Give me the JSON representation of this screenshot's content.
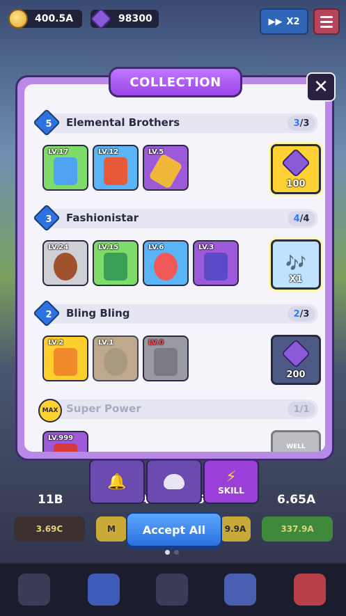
{
  "topbar": {
    "gold": "400.5A",
    "gems": "98300",
    "speed": "X2"
  },
  "modal": {
    "title": "COLLECTION",
    "sets": [
      {
        "badge": "5",
        "name": "Elemental Brothers",
        "have": "3",
        "total": "/3",
        "items": [
          {
            "lv": "LV.17"
          },
          {
            "lv": "LV.12"
          },
          {
            "lv": "LV.5"
          }
        ],
        "reward": "100"
      },
      {
        "badge": "3",
        "name": "Fashionistar",
        "have": "4",
        "total": "/4",
        "items": [
          {
            "lv": "LV.24"
          },
          {
            "lv": "LV.15"
          },
          {
            "lv": "LV.6"
          },
          {
            "lv": "LV.3"
          }
        ],
        "reward": "X1"
      },
      {
        "badge": "2",
        "name": "Bling Bling",
        "have": "2",
        "total": "/3",
        "items": [
          {
            "lv": "LV.2"
          },
          {
            "lv": "LV.1"
          },
          {
            "lv": "LV.0"
          }
        ],
        "reward": "200"
      },
      {
        "badge": "MAX",
        "name": "Super Power",
        "have": "",
        "total": "1/1",
        "items": [
          {
            "lv": "LV.999"
          }
        ],
        "reward": "WELL"
      }
    ]
  },
  "skill_tab": "SKILL",
  "accept_all": "Accept All",
  "stats": [
    "11B",
    "7.5A",
    "6",
    "6.65A"
  ],
  "costs": [
    "3.69C",
    "M",
    "9.9A",
    "337.9A"
  ]
}
